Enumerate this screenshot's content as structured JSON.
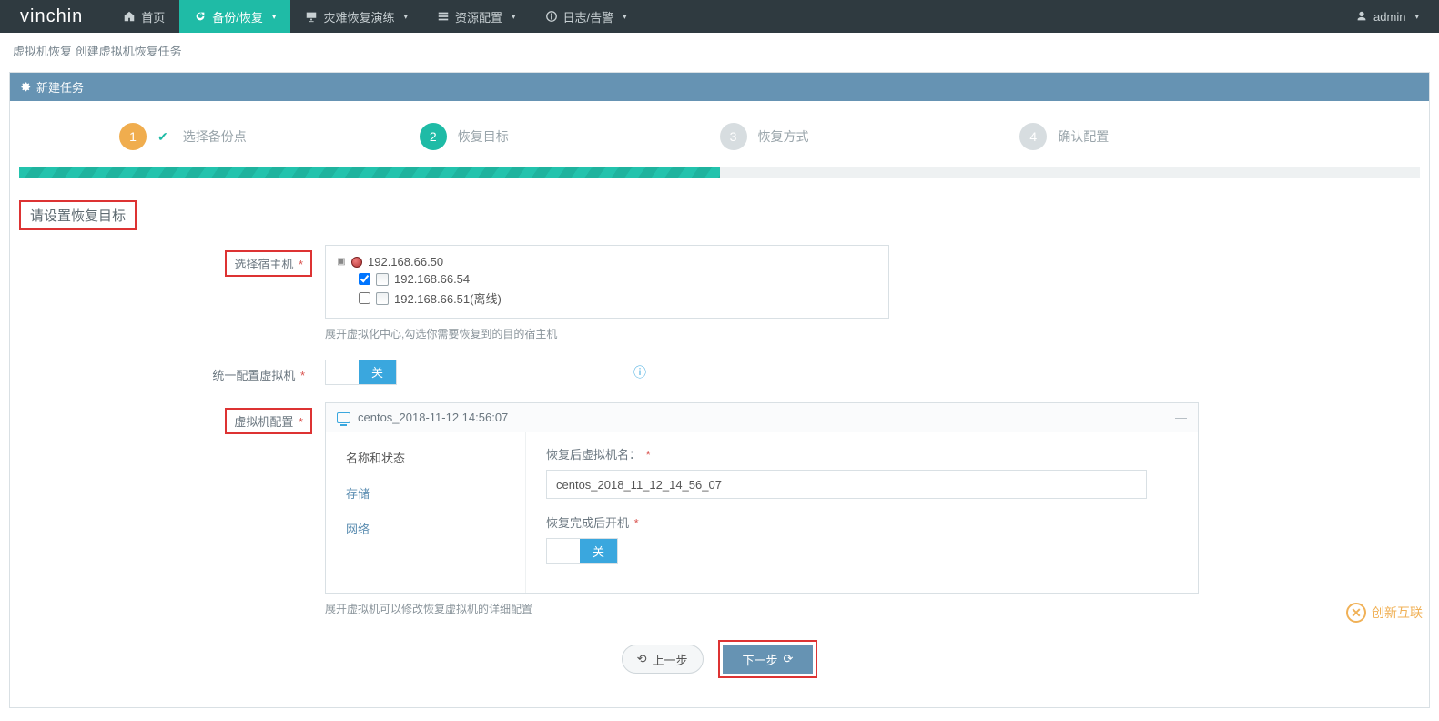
{
  "brand": "vinchin",
  "nav": {
    "home": "首页",
    "backup": "备份/恢复",
    "dr": "灾难恢复演练",
    "resource": "资源配置",
    "log": "日志/告警"
  },
  "user": {
    "name": "admin"
  },
  "breadcrumb": "虚拟机恢复 创建虚拟机恢复任务",
  "panel_title": "新建任务",
  "steps": {
    "s1": "选择备份点",
    "s2": "恢复目标",
    "s3": "恢复方式",
    "s4": "确认配置"
  },
  "section_title": "请设置恢复目标",
  "labels": {
    "select_host": "选择宿主机",
    "unify_vm": "统一配置虚拟机",
    "vm_config": "虚拟机配置"
  },
  "tree": {
    "root": "192.168.66.50",
    "host1": "192.168.66.54",
    "host2": "192.168.66.51(离线)"
  },
  "hints": {
    "host": "展开虚拟化中心,勾选你需要恢复到的目的宿主机",
    "vm": "展开虚拟机可以修改恢复虚拟机的详细配置"
  },
  "toggle_off": "关",
  "vm_header": "centos_2018-11-12 14:56:07",
  "vm_tabs": {
    "name_state": "名称和状态",
    "storage": "存储",
    "network": "网络"
  },
  "vm_form": {
    "name_label": "恢复后虚拟机名：",
    "name_value": "centos_2018_11_12_14_56_07",
    "poweron_label": "恢复完成后开机"
  },
  "buttons": {
    "prev": "上一步",
    "next": "下一步"
  },
  "watermark": "创新互联"
}
